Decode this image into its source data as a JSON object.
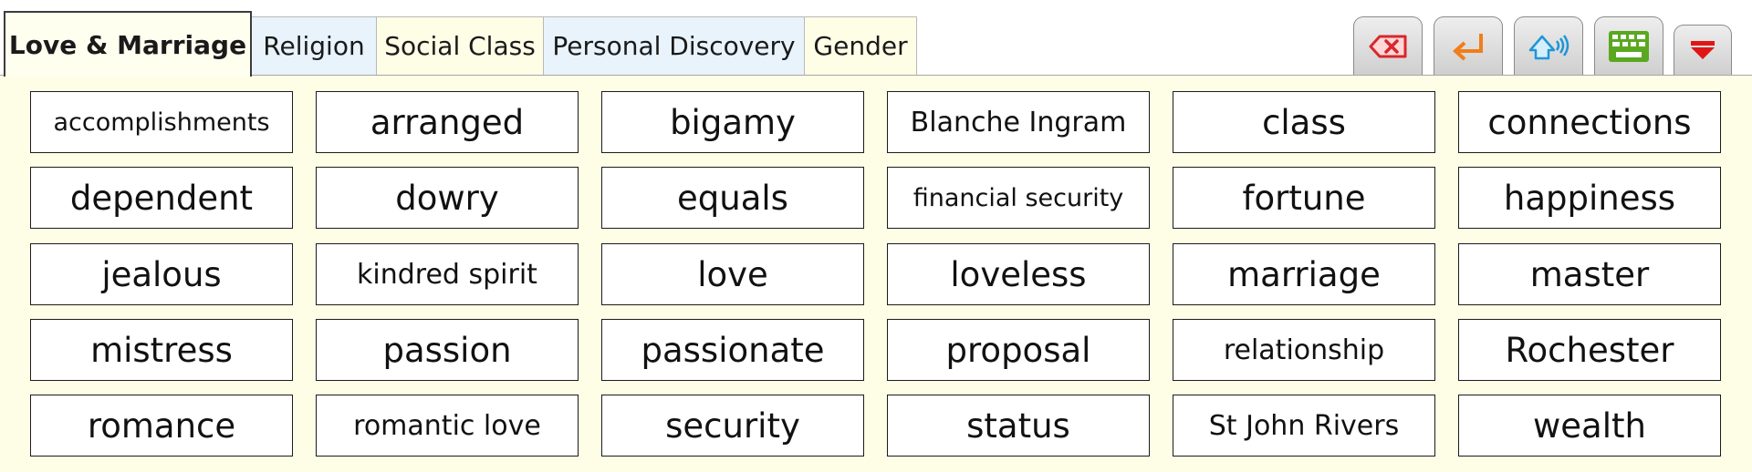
{
  "tabs": [
    {
      "label": "Love & Marriage",
      "state": "active"
    },
    {
      "label": "Religion",
      "state": "blue"
    },
    {
      "label": "Social Class",
      "state": "cream"
    },
    {
      "label": "Personal Discovery",
      "state": "blue"
    },
    {
      "label": "Gender",
      "state": "cream"
    }
  ],
  "toolbar": [
    {
      "name": "delete-button",
      "icon": "backspace-delete-icon",
      "color": "#d9262c"
    },
    {
      "name": "enter-button",
      "icon": "enter-return-icon",
      "color": "#f07e1a"
    },
    {
      "name": "speak-button",
      "icon": "speaker-sound-icon",
      "color": "#1e96d8"
    },
    {
      "name": "keyboard-button",
      "icon": "keyboard-icon",
      "color": "#5aa81f"
    },
    {
      "name": "collapse-button",
      "icon": "arrow-down-icon",
      "color": "#e01616"
    }
  ],
  "words": [
    [
      "accomplishments",
      "arranged",
      "bigamy",
      "Blanche Ingram",
      "class",
      "connections"
    ],
    [
      "dependent",
      "dowry",
      "equals",
      "financial security",
      "fortune",
      "happiness"
    ],
    [
      "jealous",
      "kindred spirit",
      "love",
      "loveless",
      "marriage",
      "master"
    ],
    [
      "mistress",
      "passion",
      "passionate",
      "proposal",
      "relationship",
      "Rochester"
    ],
    [
      "romance",
      "romantic love",
      "security",
      "status",
      "St John Rivers",
      "wealth"
    ]
  ]
}
